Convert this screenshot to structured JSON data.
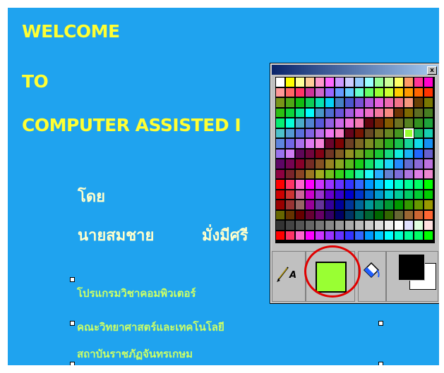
{
  "slide": {
    "title_line1": "WELCOME",
    "title_line2": "TO",
    "title_line3": "COMPUTER ASSISTED I",
    "by_label": "โดย",
    "author_first": "นายสมชาย",
    "author_last": "มั่งมีศรี",
    "program": "โปรแกรมวิชาคอมพิวเตอร์",
    "faculty": "คณะวิทยาศาสตร์และเทคโนโลยี",
    "institute": "สถาบันราชภัฏจันทรเกษม"
  },
  "palette": {
    "close_glyph": "x",
    "pencil_label": "A",
    "foreground_color": "#99ff33",
    "background_color": "#000000",
    "selected_cell": "row 5, col 13",
    "highlight_color": "#e00000"
  },
  "colors": {
    "slide_background": "#1fa3ef",
    "title_text": "#ffff33",
    "thai_big_text": "#ffffcc",
    "thai_small_text": "#ccff66"
  }
}
